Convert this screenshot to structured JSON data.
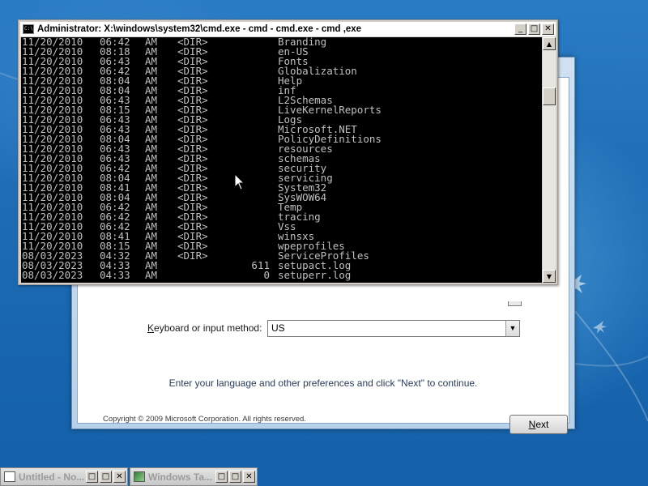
{
  "cmd": {
    "title": "Administrator: X:\\windows\\system32\\cmd.exe - cmd - cmd.exe - cmd ,exe",
    "minimize_glyph": "_",
    "maximize_glyph": "□",
    "close_glyph": "✕",
    "scroll_up_glyph": "▲",
    "scroll_down_glyph": "▼",
    "lines": [
      {
        "date": "11/20/2010",
        "time": "06:42",
        "ampm": "AM",
        "kind": "<DIR>",
        "size": "",
        "name": "Branding"
      },
      {
        "date": "11/20/2010",
        "time": "08:18",
        "ampm": "AM",
        "kind": "<DIR>",
        "size": "",
        "name": "en-US"
      },
      {
        "date": "11/20/2010",
        "time": "06:43",
        "ampm": "AM",
        "kind": "<DIR>",
        "size": "",
        "name": "Fonts"
      },
      {
        "date": "11/20/2010",
        "time": "06:42",
        "ampm": "AM",
        "kind": "<DIR>",
        "size": "",
        "name": "Globalization"
      },
      {
        "date": "11/20/2010",
        "time": "08:04",
        "ampm": "AM",
        "kind": "<DIR>",
        "size": "",
        "name": "Help"
      },
      {
        "date": "11/20/2010",
        "time": "08:04",
        "ampm": "AM",
        "kind": "<DIR>",
        "size": "",
        "name": "inf"
      },
      {
        "date": "11/20/2010",
        "time": "06:43",
        "ampm": "AM",
        "kind": "<DIR>",
        "size": "",
        "name": "L2Schemas"
      },
      {
        "date": "11/20/2010",
        "time": "08:15",
        "ampm": "AM",
        "kind": "<DIR>",
        "size": "",
        "name": "LiveKernelReports"
      },
      {
        "date": "11/20/2010",
        "time": "06:43",
        "ampm": "AM",
        "kind": "<DIR>",
        "size": "",
        "name": "Logs"
      },
      {
        "date": "11/20/2010",
        "time": "06:43",
        "ampm": "AM",
        "kind": "<DIR>",
        "size": "",
        "name": "Microsoft.NET"
      },
      {
        "date": "11/20/2010",
        "time": "08:04",
        "ampm": "AM",
        "kind": "<DIR>",
        "size": "",
        "name": "PolicyDefinitions"
      },
      {
        "date": "11/20/2010",
        "time": "06:43",
        "ampm": "AM",
        "kind": "<DIR>",
        "size": "",
        "name": "resources"
      },
      {
        "date": "11/20/2010",
        "time": "06:43",
        "ampm": "AM",
        "kind": "<DIR>",
        "size": "",
        "name": "schemas"
      },
      {
        "date": "11/20/2010",
        "time": "06:42",
        "ampm": "AM",
        "kind": "<DIR>",
        "size": "",
        "name": "security"
      },
      {
        "date": "11/20/2010",
        "time": "08:04",
        "ampm": "AM",
        "kind": "<DIR>",
        "size": "",
        "name": "servicing"
      },
      {
        "date": "11/20/2010",
        "time": "08:41",
        "ampm": "AM",
        "kind": "<DIR>",
        "size": "",
        "name": "System32"
      },
      {
        "date": "11/20/2010",
        "time": "08:04",
        "ampm": "AM",
        "kind": "<DIR>",
        "size": "",
        "name": "SysWOW64"
      },
      {
        "date": "11/20/2010",
        "time": "06:42",
        "ampm": "AM",
        "kind": "<DIR>",
        "size": "",
        "name": "Temp"
      },
      {
        "date": "11/20/2010",
        "time": "06:42",
        "ampm": "AM",
        "kind": "<DIR>",
        "size": "",
        "name": "tracing"
      },
      {
        "date": "11/20/2010",
        "time": "06:42",
        "ampm": "AM",
        "kind": "<DIR>",
        "size": "",
        "name": "Vss"
      },
      {
        "date": "11/20/2010",
        "time": "08:41",
        "ampm": "AM",
        "kind": "<DIR>",
        "size": "",
        "name": "winsxs"
      },
      {
        "date": "11/20/2010",
        "time": "08:15",
        "ampm": "AM",
        "kind": "<DIR>",
        "size": "",
        "name": "wpeprofiles"
      },
      {
        "date": "08/03/2023",
        "time": "04:32",
        "ampm": "AM",
        "kind": "<DIR>",
        "size": "",
        "name": "ServiceProfiles"
      },
      {
        "date": "08/03/2023",
        "time": "04:33",
        "ampm": "AM",
        "kind": "",
        "size": "611",
        "name": "setupact.log"
      },
      {
        "date": "08/03/2023",
        "time": "04:33",
        "ampm": "AM",
        "kind": "",
        "size": "0",
        "name": "setuperr.log"
      }
    ]
  },
  "setup": {
    "keyboard_label_accel": "K",
    "keyboard_label_rest": "eyboard or input method:",
    "keyboard_value": "US",
    "dropdown_glyph": "▼",
    "instruction": "Enter your language and other preferences and click \"Next\" to continue.",
    "copyright": "Copyright © 2009 Microsoft Corporation. All rights reserved.",
    "next_accel": "N",
    "next_rest": "ext"
  },
  "taskbar": {
    "windows": [
      {
        "label": "Untitled - No..."
      },
      {
        "label": "Windows Ta..."
      }
    ]
  },
  "colors": {
    "console_bg": "#000000",
    "console_text": "#c0c0c0",
    "desktop": "#1f6fb6"
  }
}
